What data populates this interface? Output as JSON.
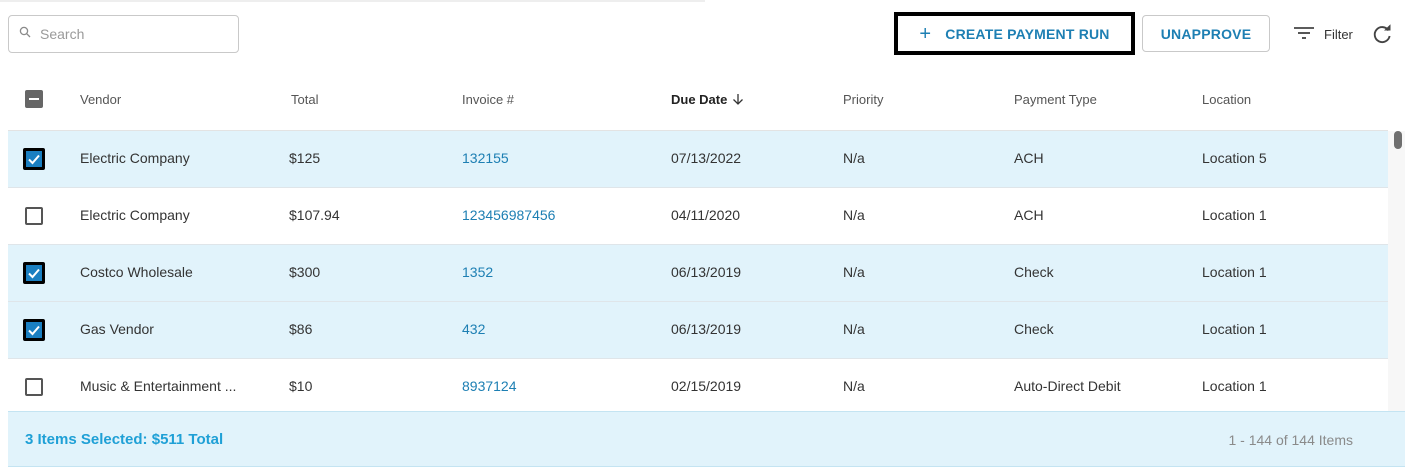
{
  "search": {
    "placeholder": "Search",
    "value": ""
  },
  "toolbar": {
    "create_label": "CREATE PAYMENT RUN",
    "unapprove_label": "UNAPPROVE",
    "filter_label": "Filter"
  },
  "columns": {
    "vendor": "Vendor",
    "total": "Total",
    "invoice": "Invoice #",
    "due_date": "Due Date",
    "priority": "Priority",
    "payment_type": "Payment Type",
    "location": "Location"
  },
  "rows": [
    {
      "selected": true,
      "vendor": "Electric Company",
      "total": "$125",
      "invoice": "132155",
      "due_date": "07/13/2022",
      "priority": "N/a",
      "payment_type": "ACH",
      "location": "Location 5"
    },
    {
      "selected": false,
      "vendor": "Electric Company",
      "total": "$107.94",
      "invoice": "123456987456",
      "due_date": "04/11/2020",
      "priority": "N/a",
      "payment_type": "ACH",
      "location": "Location 1"
    },
    {
      "selected": true,
      "vendor": "Costco Wholesale",
      "total": "$300",
      "invoice": "1352",
      "due_date": "06/13/2019",
      "priority": "N/a",
      "payment_type": "Check",
      "location": "Location 1"
    },
    {
      "selected": true,
      "vendor": "Gas Vendor",
      "total": "$86",
      "invoice": "432",
      "due_date": "06/13/2019",
      "priority": "N/a",
      "payment_type": "Check",
      "location": "Location 1"
    },
    {
      "selected": false,
      "vendor": "Music & Entertainment ...",
      "total": "$10",
      "invoice": "8937124",
      "due_date": "02/15/2019",
      "priority": "N/a",
      "payment_type": "Auto-Direct Debit",
      "location": "Location 1"
    }
  ],
  "footer": {
    "selection_summary": "3 Items Selected: $511 Total",
    "pager": "1 - 144 of 144 Items"
  },
  "colors": {
    "accent": "#1d7fb3",
    "selected_row": "#e1f3fb",
    "summary_text": "#1fa0d6"
  },
  "icons": {
    "search": "search-icon",
    "plus": "plus-icon",
    "filter": "filter-icon",
    "refresh": "refresh-icon",
    "sort": "arrow-down-icon",
    "check": "checkmark-icon"
  }
}
